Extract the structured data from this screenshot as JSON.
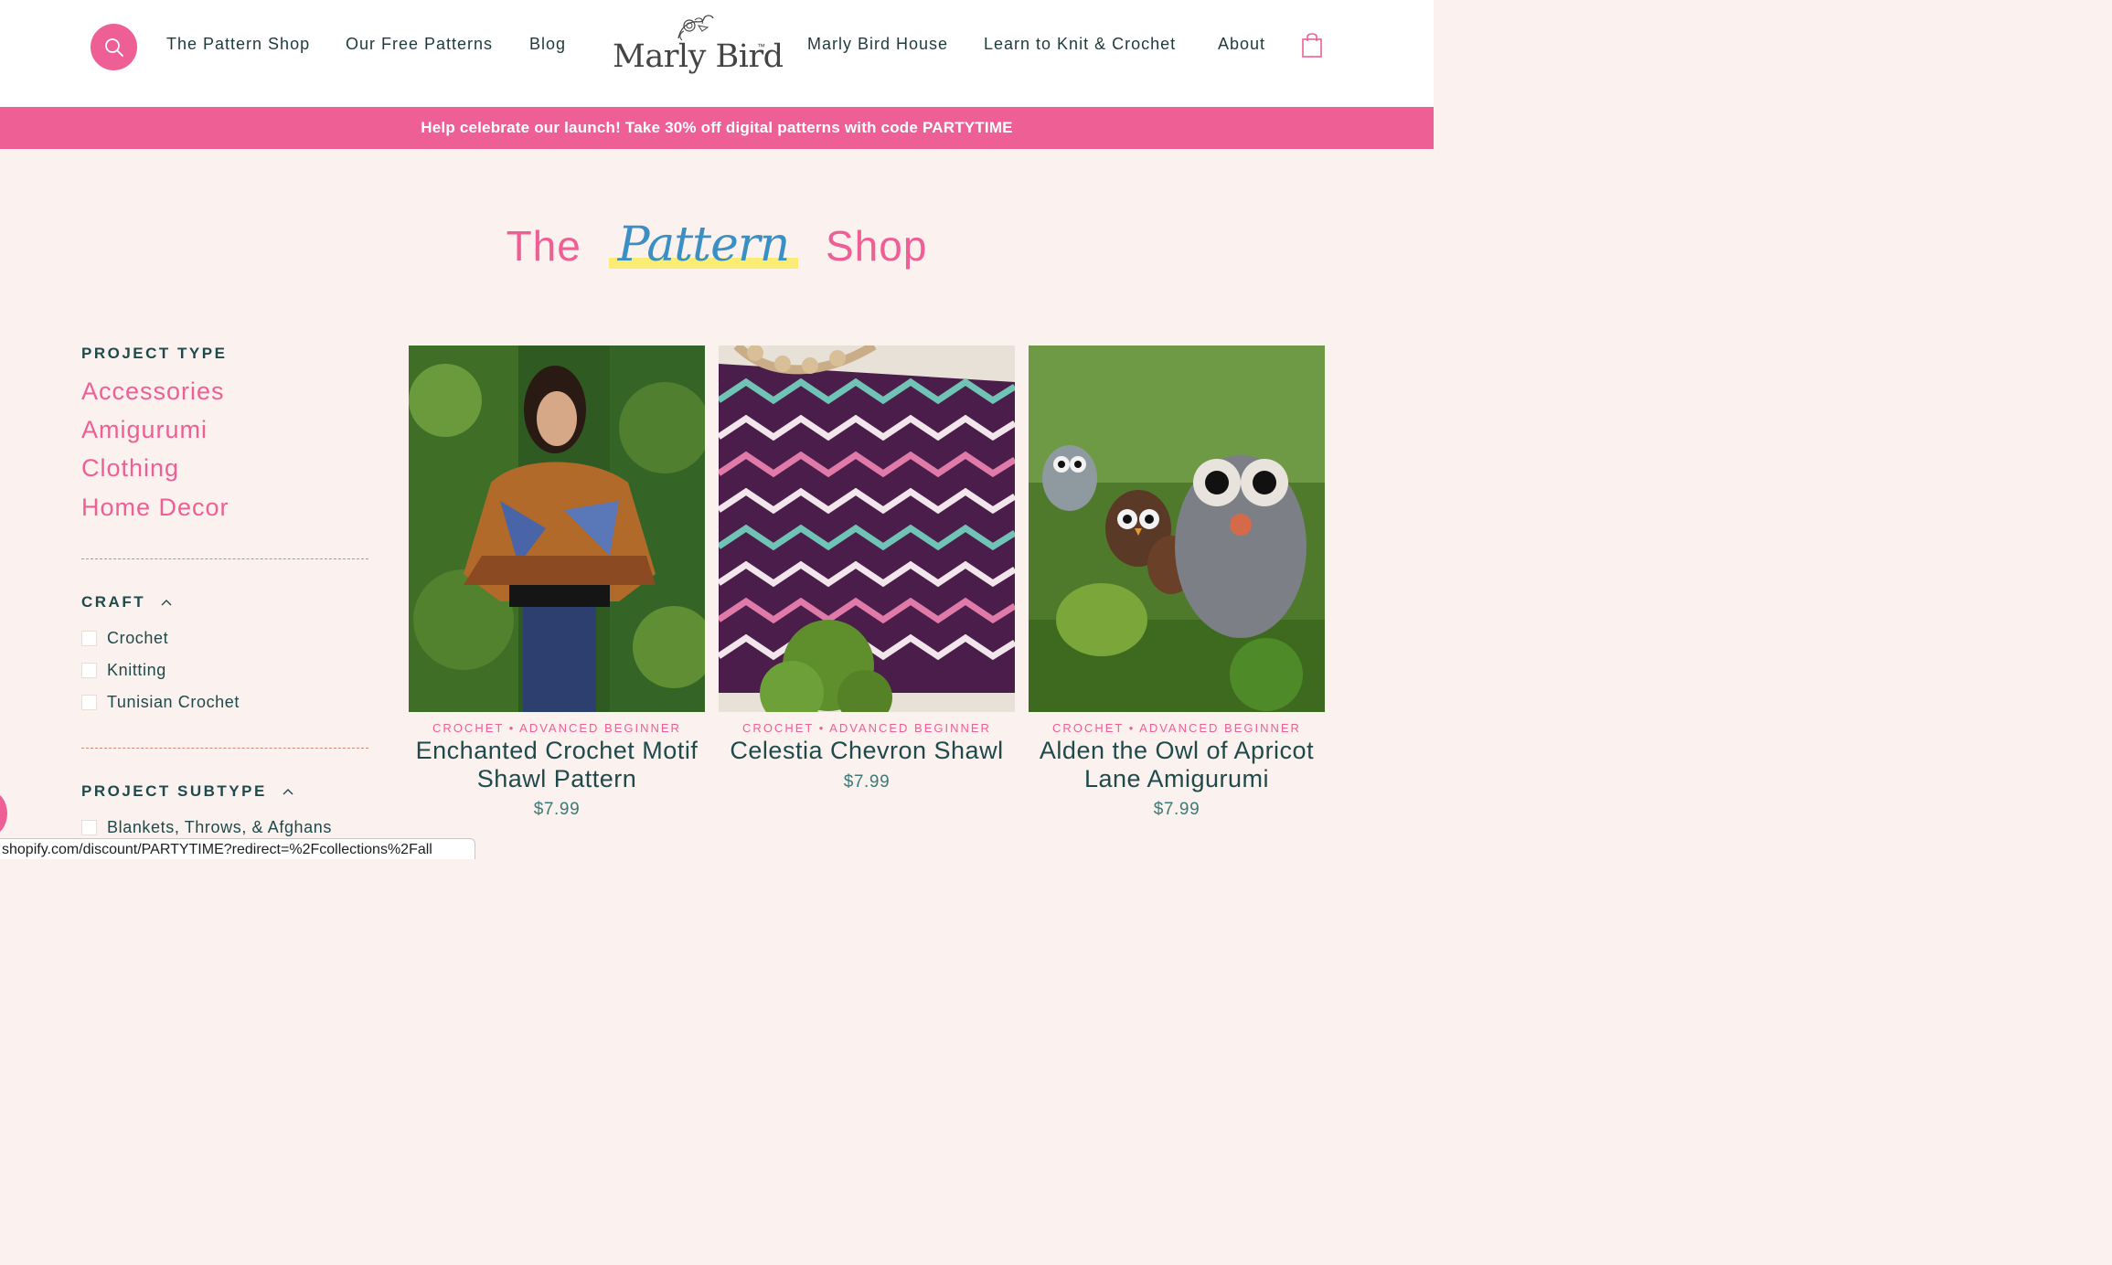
{
  "header": {
    "nav_left": [
      "The Pattern Shop",
      "Our Free Patterns",
      "Blog"
    ],
    "logo_text": "Marly Bird",
    "logo_tm": "™",
    "nav_right": [
      "Marly Bird House",
      "Learn to Knit & Crochet",
      "About"
    ]
  },
  "promo": {
    "text": "Help celebrate our launch! Take 30% off digital patterns with code PARTYTIME"
  },
  "page_title": {
    "before": "The",
    "script": "Pattern",
    "after": "Shop"
  },
  "sidebar": {
    "project_type": {
      "heading": "PROJECT TYPE",
      "items": [
        "Accessories",
        "Amigurumi",
        "Clothing",
        "Home Decor"
      ]
    },
    "craft": {
      "heading": "CRAFT",
      "items": [
        "Crochet",
        "Knitting",
        "Tunisian Crochet"
      ]
    },
    "project_subtype": {
      "heading": "PROJECT SUBTYPE",
      "items": [
        "Blankets, Throws, & Afghans"
      ]
    }
  },
  "products": [
    {
      "meta": "CROCHET • ADVANCED BEGINNER",
      "title": "Enchanted Crochet Motif Shawl Pattern",
      "price": "$7.99"
    },
    {
      "meta": "CROCHET • ADVANCED BEGINNER",
      "title": "Celestia Chevron Shawl",
      "price": "$7.99"
    },
    {
      "meta": "CROCHET • ADVANCED BEGINNER",
      "title": "Alden the Owl of Apricot Lane Amigurumi",
      "price": "$7.99"
    }
  ],
  "status_bar": {
    "url": "shopify.com/discount/PARTYTIME?redirect=%2Fcollections%2Fall"
  },
  "colors": {
    "accent_pink": "#ee5f95",
    "teal_text": "#1f4a4c",
    "page_bg": "#fbf1ee",
    "script_blue": "#3a8fc4",
    "highlight_yellow": "#fbec75"
  },
  "icons": {
    "search": "search-icon",
    "cart": "shopping-bag-icon",
    "caret": "chevron-up-icon"
  }
}
